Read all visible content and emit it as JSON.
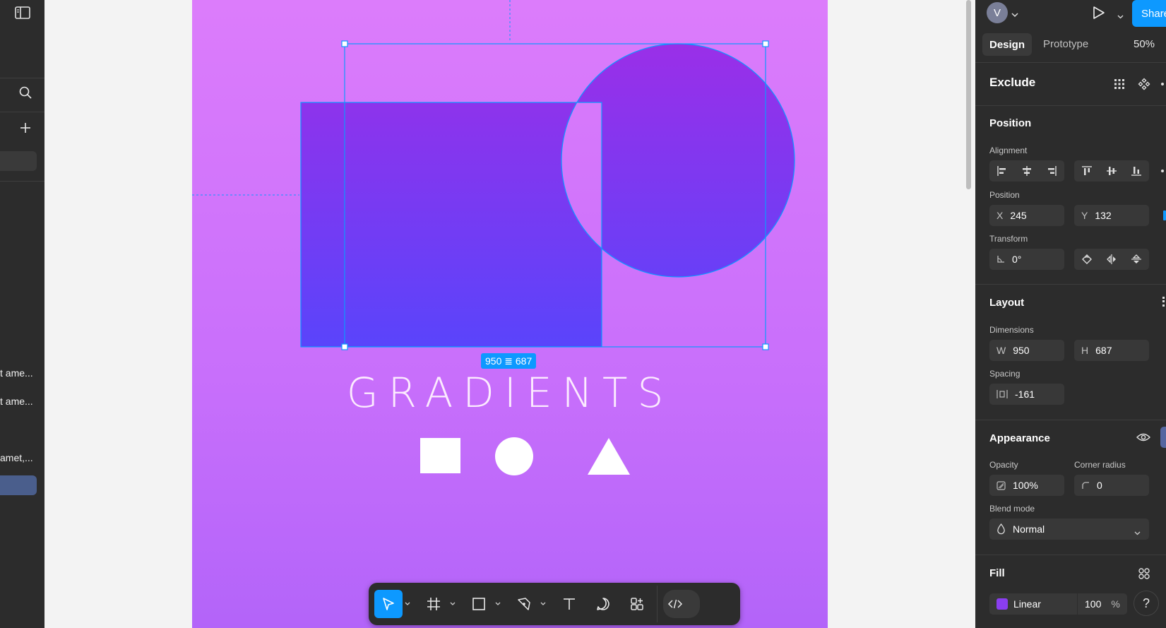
{
  "left_sidebar": {
    "layer_items": [
      {
        "label": "t ame..."
      },
      {
        "label": "t ame..."
      },
      {
        "label": "amet,..."
      }
    ]
  },
  "canvas": {
    "artboard_title": "GRADIENTS",
    "selection_size_badge": "950 ≣ 687",
    "colors": {
      "selection": "#0d99ff",
      "shape_gradient_top": "#9a2fe8",
      "shape_gradient_bottom": "#5a44fb"
    }
  },
  "toolbar": {
    "tools": [
      "move-tool",
      "frame-tool",
      "rectangle-tool",
      "pen-tool",
      "text-tool",
      "comment-tool",
      "components-tool",
      "dev-mode-toggle"
    ]
  },
  "header": {
    "avatar_initial": "V",
    "share_label": "Share",
    "tab_design": "Design",
    "tab_prototype": "Prototype",
    "zoom": "50%"
  },
  "layer": {
    "name": "Exclude"
  },
  "position_section": {
    "title": "Position",
    "alignment_label": "Alignment",
    "position_label": "Position",
    "x_label": "X",
    "x_value": "245",
    "y_label": "Y",
    "y_value": "132",
    "transform_label": "Transform",
    "rotation_value": "0°"
  },
  "layout_section": {
    "title": "Layout",
    "dimensions_label": "Dimensions",
    "w_label": "W",
    "w_value": "950",
    "h_label": "H",
    "h_value": "687",
    "spacing_label": "Spacing",
    "spacing_value": "-161"
  },
  "appearance_section": {
    "title": "Appearance",
    "opacity_label": "Opacity",
    "opacity_value": "100%",
    "corner_radius_label": "Corner radius",
    "corner_radius_value": "0",
    "blend_mode_label": "Blend mode",
    "blend_mode_value": "Normal"
  },
  "fill_section": {
    "title": "Fill",
    "fill_type": "Linear",
    "fill_opacity": "100",
    "percent_sign": "%",
    "swatch_color": "#8a3ef0"
  },
  "help_label": "?"
}
